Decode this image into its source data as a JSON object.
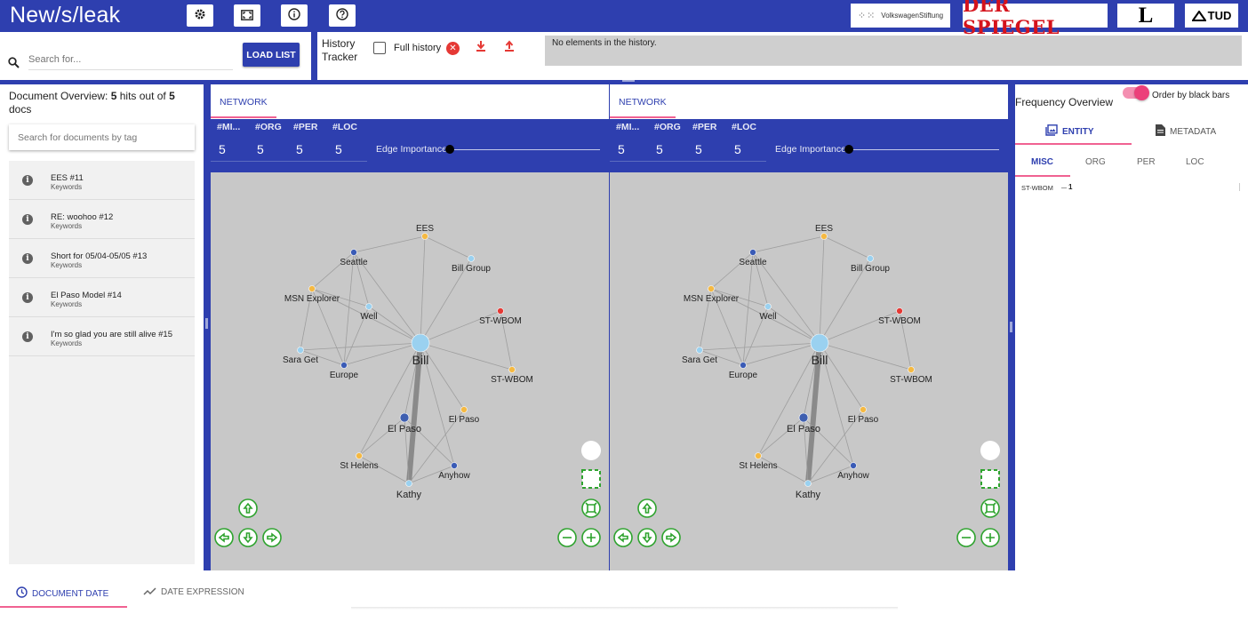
{
  "app": {
    "title": "New/s/leak"
  },
  "toolbar": {
    "icons": [
      "gear-icon",
      "fullscreen-icon",
      "info-icon",
      "help-icon"
    ],
    "logos": {
      "vw": "VolkswagenStiftung",
      "spiegel": "DER SPIEGEL",
      "l": "L",
      "tud": "TUD"
    }
  },
  "search": {
    "placeholder": "Search for...",
    "load_label": "LOAD LIST"
  },
  "history": {
    "title_1": "History",
    "title_2": "Tracker",
    "full_history_label": "Full history",
    "empty_message": "No elements in the history."
  },
  "documents": {
    "title_prefix": "Document Overview: ",
    "hits": "5",
    "title_mid": " hits out of ",
    "total": "5",
    "title_suffix": " docs",
    "tag_search_placeholder": "Search for documents by tag",
    "items": [
      {
        "name": "EES #11",
        "sub": "Keywords"
      },
      {
        "name": "RE: woohoo #12",
        "sub": "Keywords"
      },
      {
        "name": "Short for 05/04-05/05 #13",
        "sub": "Keywords"
      },
      {
        "name": "El Paso Model #14",
        "sub": "Keywords"
      },
      {
        "name": "I'm so glad you are still alive #15",
        "sub": "Keywords"
      }
    ]
  },
  "network": {
    "tab_label": "NETWORK",
    "stats": [
      {
        "label": "#MI...",
        "value": "5"
      },
      {
        "label": "#ORG",
        "value": "5"
      },
      {
        "label": "#PER",
        "value": "5"
      },
      {
        "label": "#LOC",
        "value": "5"
      }
    ],
    "edge_importance_label": "Edge Importance",
    "edge_importance": 0,
    "colors": {
      "misc": "#f5b942",
      "org": "#9ad1f0",
      "per": "#3f5fb0",
      "loc": "#3a5bb6",
      "highlight": "#e53935",
      "canvas": "#c8c8c8"
    },
    "nodes": [
      {
        "id": "bill",
        "label": "Bill",
        "type": "per-main"
      },
      {
        "id": "seattle",
        "label": "Seattle",
        "type": "loc"
      },
      {
        "id": "ees",
        "label": "EES",
        "type": "misc"
      },
      {
        "id": "billgroup",
        "label": "Bill Group",
        "type": "org"
      },
      {
        "id": "msn",
        "label": "MSN Explorer",
        "type": "misc"
      },
      {
        "id": "well",
        "label": "Well",
        "type": "org"
      },
      {
        "id": "stwbom1",
        "label": "ST-WBOM",
        "type": "highlight"
      },
      {
        "id": "saraget",
        "label": "Sara Get",
        "type": "org"
      },
      {
        "id": "europe",
        "label": "Europe",
        "type": "loc"
      },
      {
        "id": "stwbom2",
        "label": "ST-WBOM",
        "type": "misc"
      },
      {
        "id": "elpaso1",
        "label": "El Paso",
        "type": "loc"
      },
      {
        "id": "elpaso2",
        "label": "El Paso",
        "type": "misc"
      },
      {
        "id": "sthelens",
        "label": "St Helens",
        "type": "misc"
      },
      {
        "id": "anyhow",
        "label": "Anyhow",
        "type": "loc"
      },
      {
        "id": "kathy",
        "label": "Kathy",
        "type": "org"
      }
    ],
    "edges": [
      [
        "bill",
        "seattle"
      ],
      [
        "bill",
        "ees"
      ],
      [
        "bill",
        "billgroup"
      ],
      [
        "bill",
        "msn"
      ],
      [
        "bill",
        "well"
      ],
      [
        "bill",
        "stwbom1"
      ],
      [
        "bill",
        "saraget"
      ],
      [
        "bill",
        "europe"
      ],
      [
        "bill",
        "stwbom2"
      ],
      [
        "bill",
        "elpaso1"
      ],
      [
        "bill",
        "elpaso2"
      ],
      [
        "bill",
        "sthelens"
      ],
      [
        "bill",
        "anyhow"
      ],
      [
        "bill",
        "kathy"
      ],
      [
        "seattle",
        "msn"
      ],
      [
        "seattle",
        "well"
      ],
      [
        "seattle",
        "europe"
      ],
      [
        "ees",
        "billgroup"
      ],
      [
        "ees",
        "seattle"
      ],
      [
        "msn",
        "well"
      ],
      [
        "msn",
        "europe"
      ],
      [
        "msn",
        "saraget"
      ],
      [
        "well",
        "europe"
      ],
      [
        "saraget",
        "europe"
      ],
      [
        "elpaso1",
        "kathy"
      ],
      [
        "elpaso1",
        "sthelens"
      ],
      [
        "elpaso1",
        "anyhow"
      ],
      [
        "elpaso2",
        "kathy"
      ],
      [
        "sthelens",
        "kathy"
      ],
      [
        "anyhow",
        "kathy"
      ],
      [
        "stwbom1",
        "stwbom2"
      ]
    ]
  },
  "frequency": {
    "title": "Frequency Overview",
    "order_label": "Order by black bars",
    "tabs": {
      "entity": "ENTITY",
      "metadata": "METADATA"
    },
    "subtabs": [
      "MISC",
      "ORG",
      "PER",
      "LOC"
    ],
    "rows": [
      {
        "label": "ST-WBOM",
        "count": "1"
      }
    ]
  },
  "bottom": {
    "tab_date": "DOCUMENT DATE",
    "tab_expr": "DATE EXPRESSION"
  }
}
